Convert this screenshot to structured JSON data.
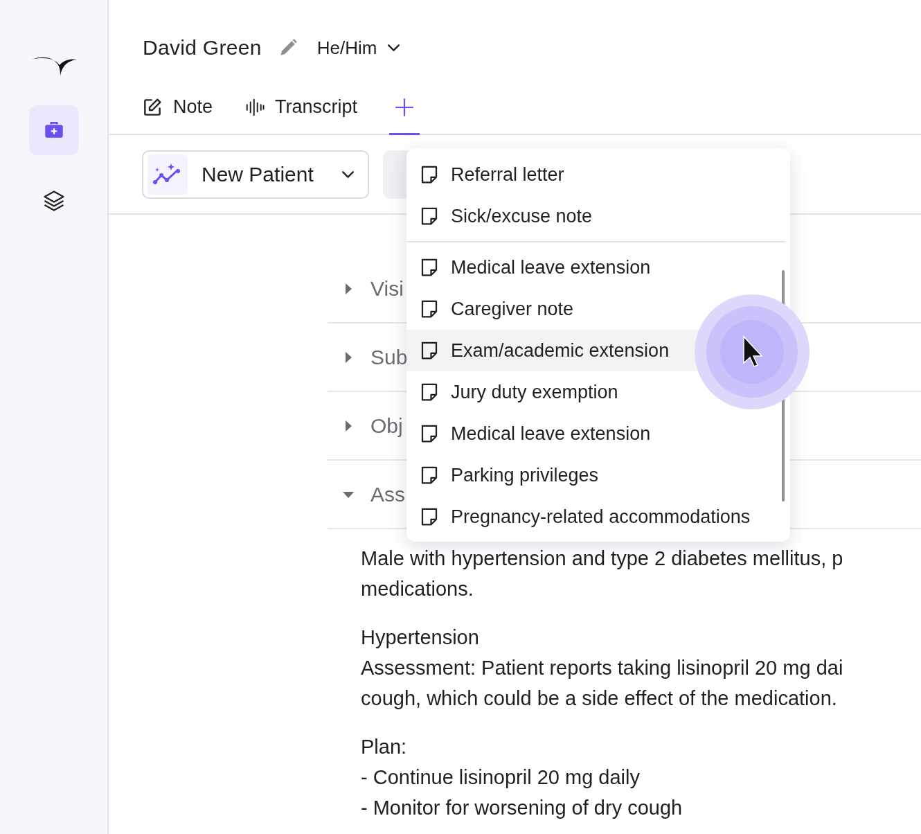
{
  "sidebar": {
    "items": [
      {
        "kind": "briefcase",
        "selected": true
      },
      {
        "kind": "layers",
        "selected": false
      }
    ]
  },
  "header": {
    "patient_name": "David Green",
    "pronouns": "He/Him"
  },
  "tabs": [
    {
      "kind": "note",
      "label": "Note",
      "selected": false
    },
    {
      "kind": "transcript",
      "label": "Transcript",
      "selected": false
    },
    {
      "kind": "add",
      "selected": true
    }
  ],
  "toolbar": {
    "template": "New Patient"
  },
  "sections": [
    {
      "title": "Visi",
      "expanded": false
    },
    {
      "title": "Sub",
      "expanded": false
    },
    {
      "title": "Obj",
      "expanded": false
    },
    {
      "title": "Ass",
      "expanded": true
    }
  ],
  "assessment_body": [
    [
      "Male with hypertension and type 2 diabetes mellitus, p",
      "medications."
    ],
    [
      "Hypertension",
      "Assessment: Patient reports taking lisinopril 20 mg dai",
      "cough, which could be a side effect of the medication."
    ],
    [
      "Plan:",
      "- Continue lisinopril 20 mg daily",
      "- Monitor for worsening of dry cough"
    ]
  ],
  "menu": {
    "pinned_items": [
      {
        "label": "Referral letter",
        "hovered": false
      },
      {
        "label": "Sick/excuse note",
        "hovered": false
      }
    ],
    "items": [
      {
        "label": "Medical leave extension",
        "hovered": false
      },
      {
        "label": "Caregiver note",
        "hovered": false
      },
      {
        "label": "Exam/academic extension",
        "hovered": true
      },
      {
        "label": "Jury duty exemption",
        "hovered": false
      },
      {
        "label": "Medical leave extension",
        "hovered": false
      },
      {
        "label": "Parking privileges",
        "hovered": false
      },
      {
        "label": "Pregnancy-related accommodations",
        "hovered": false
      }
    ]
  }
}
